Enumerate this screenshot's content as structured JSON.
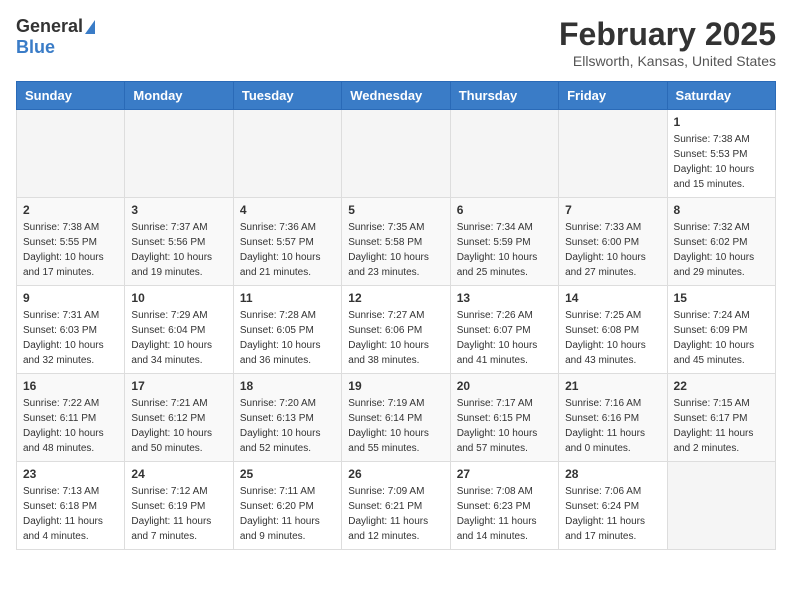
{
  "header": {
    "logo_general": "General",
    "logo_blue": "Blue",
    "month_year": "February 2025",
    "location": "Ellsworth, Kansas, United States"
  },
  "weekdays": [
    "Sunday",
    "Monday",
    "Tuesday",
    "Wednesday",
    "Thursday",
    "Friday",
    "Saturday"
  ],
  "weeks": [
    [
      {
        "day": "",
        "info": ""
      },
      {
        "day": "",
        "info": ""
      },
      {
        "day": "",
        "info": ""
      },
      {
        "day": "",
        "info": ""
      },
      {
        "day": "",
        "info": ""
      },
      {
        "day": "",
        "info": ""
      },
      {
        "day": "1",
        "info": "Sunrise: 7:38 AM\nSunset: 5:53 PM\nDaylight: 10 hours and 15 minutes."
      }
    ],
    [
      {
        "day": "2",
        "info": "Sunrise: 7:38 AM\nSunset: 5:55 PM\nDaylight: 10 hours and 17 minutes."
      },
      {
        "day": "3",
        "info": "Sunrise: 7:37 AM\nSunset: 5:56 PM\nDaylight: 10 hours and 19 minutes."
      },
      {
        "day": "4",
        "info": "Sunrise: 7:36 AM\nSunset: 5:57 PM\nDaylight: 10 hours and 21 minutes."
      },
      {
        "day": "5",
        "info": "Sunrise: 7:35 AM\nSunset: 5:58 PM\nDaylight: 10 hours and 23 minutes."
      },
      {
        "day": "6",
        "info": "Sunrise: 7:34 AM\nSunset: 5:59 PM\nDaylight: 10 hours and 25 minutes."
      },
      {
        "day": "7",
        "info": "Sunrise: 7:33 AM\nSunset: 6:00 PM\nDaylight: 10 hours and 27 minutes."
      },
      {
        "day": "8",
        "info": "Sunrise: 7:32 AM\nSunset: 6:02 PM\nDaylight: 10 hours and 29 minutes."
      }
    ],
    [
      {
        "day": "9",
        "info": "Sunrise: 7:31 AM\nSunset: 6:03 PM\nDaylight: 10 hours and 32 minutes."
      },
      {
        "day": "10",
        "info": "Sunrise: 7:29 AM\nSunset: 6:04 PM\nDaylight: 10 hours and 34 minutes."
      },
      {
        "day": "11",
        "info": "Sunrise: 7:28 AM\nSunset: 6:05 PM\nDaylight: 10 hours and 36 minutes."
      },
      {
        "day": "12",
        "info": "Sunrise: 7:27 AM\nSunset: 6:06 PM\nDaylight: 10 hours and 38 minutes."
      },
      {
        "day": "13",
        "info": "Sunrise: 7:26 AM\nSunset: 6:07 PM\nDaylight: 10 hours and 41 minutes."
      },
      {
        "day": "14",
        "info": "Sunrise: 7:25 AM\nSunset: 6:08 PM\nDaylight: 10 hours and 43 minutes."
      },
      {
        "day": "15",
        "info": "Sunrise: 7:24 AM\nSunset: 6:09 PM\nDaylight: 10 hours and 45 minutes."
      }
    ],
    [
      {
        "day": "16",
        "info": "Sunrise: 7:22 AM\nSunset: 6:11 PM\nDaylight: 10 hours and 48 minutes."
      },
      {
        "day": "17",
        "info": "Sunrise: 7:21 AM\nSunset: 6:12 PM\nDaylight: 10 hours and 50 minutes."
      },
      {
        "day": "18",
        "info": "Sunrise: 7:20 AM\nSunset: 6:13 PM\nDaylight: 10 hours and 52 minutes."
      },
      {
        "day": "19",
        "info": "Sunrise: 7:19 AM\nSunset: 6:14 PM\nDaylight: 10 hours and 55 minutes."
      },
      {
        "day": "20",
        "info": "Sunrise: 7:17 AM\nSunset: 6:15 PM\nDaylight: 10 hours and 57 minutes."
      },
      {
        "day": "21",
        "info": "Sunrise: 7:16 AM\nSunset: 6:16 PM\nDaylight: 11 hours and 0 minutes."
      },
      {
        "day": "22",
        "info": "Sunrise: 7:15 AM\nSunset: 6:17 PM\nDaylight: 11 hours and 2 minutes."
      }
    ],
    [
      {
        "day": "23",
        "info": "Sunrise: 7:13 AM\nSunset: 6:18 PM\nDaylight: 11 hours and 4 minutes."
      },
      {
        "day": "24",
        "info": "Sunrise: 7:12 AM\nSunset: 6:19 PM\nDaylight: 11 hours and 7 minutes."
      },
      {
        "day": "25",
        "info": "Sunrise: 7:11 AM\nSunset: 6:20 PM\nDaylight: 11 hours and 9 minutes."
      },
      {
        "day": "26",
        "info": "Sunrise: 7:09 AM\nSunset: 6:21 PM\nDaylight: 11 hours and 12 minutes."
      },
      {
        "day": "27",
        "info": "Sunrise: 7:08 AM\nSunset: 6:23 PM\nDaylight: 11 hours and 14 minutes."
      },
      {
        "day": "28",
        "info": "Sunrise: 7:06 AM\nSunset: 6:24 PM\nDaylight: 11 hours and 17 minutes."
      },
      {
        "day": "",
        "info": ""
      }
    ]
  ]
}
